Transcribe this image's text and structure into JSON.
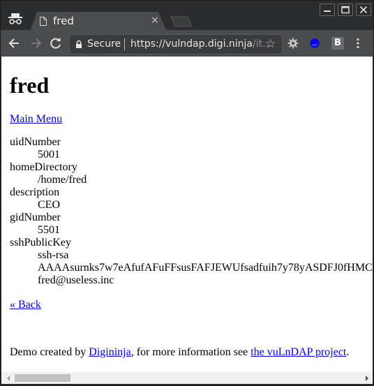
{
  "browser": {
    "tab": {
      "title": "fred",
      "close_glyph": "×"
    },
    "omnibox": {
      "security_label": "Secure",
      "url_host": "https://vulndap.digi.ninja",
      "url_path": "/it...",
      "star_glyph": "☆"
    },
    "extensions": {
      "b_label": "B",
      "blue_ext_color": "#0000ee"
    },
    "window_controls": [
      "minimize",
      "maximize",
      "close"
    ]
  },
  "page": {
    "heading": "fred",
    "main_menu_link": "Main Menu",
    "attributes": [
      {
        "name": "uidNumber",
        "values": [
          "5001"
        ]
      },
      {
        "name": "homeDirectory",
        "values": [
          "/home/fred"
        ]
      },
      {
        "name": "description",
        "values": [
          "CEO"
        ]
      },
      {
        "name": "gidNumber",
        "values": [
          "5501"
        ]
      },
      {
        "name": "sshPublicKey",
        "values": [
          "ssh-rsa",
          "AAAAsurnks7w7eAfufAFuFFsusFAFJEWUfsadfuih7y78yASDFJ0fHMC",
          "fred@useless.inc"
        ]
      }
    ],
    "back_link": "« Back",
    "footer": {
      "prefix": "Demo created by ",
      "author_link": "Digininja",
      "middle": ", for more information see ",
      "project_link": "the vuLnDAP project",
      "suffix": "."
    }
  },
  "colors": {
    "link": "#0000ee",
    "chrome_dark": "#2b2c2e",
    "toolbar": "#4a4b4d"
  }
}
